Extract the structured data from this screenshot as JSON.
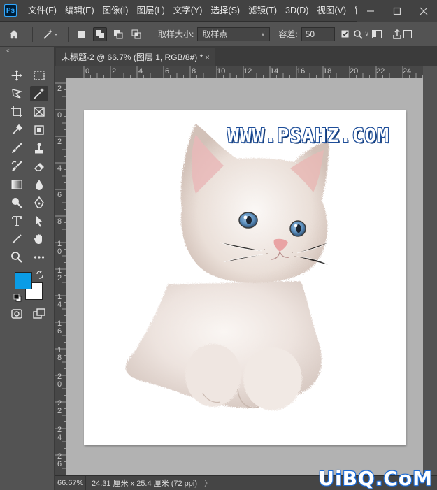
{
  "app": {
    "logo": "Ps",
    "menu": [
      "文件(F)",
      "编辑(E)",
      "图像(I)",
      "图层(L)",
      "文字(Y)",
      "选择(S)",
      "滤镜(T)",
      "3D(D)",
      "视图(V)",
      "窗口(W"
    ],
    "window_controls": [
      "minimize-icon",
      "maximize-icon",
      "close-icon"
    ]
  },
  "options": {
    "sample_size_label": "取样大小:",
    "sample_size_value": "取样点",
    "tolerance_label": "容差:",
    "tolerance_value": "50"
  },
  "document": {
    "tab_title": "未标题-2 @ 66.7% (图层 1, RGB/8#) *",
    "tab_close": "×"
  },
  "rulers": {
    "top": [
      "0",
      "2",
      "4",
      "6",
      "8",
      "10",
      "12",
      "14",
      "16",
      "18",
      "20",
      "22",
      "24"
    ],
    "left": [
      "2",
      "0",
      "2",
      "4",
      "6",
      "8",
      "1 0",
      "1 2",
      "1 4",
      "1 6",
      "1 8",
      "2 0",
      "2 2",
      "2 4",
      "2 6"
    ]
  },
  "canvas": {
    "watermark_text": "WWW.PSAHZ.COM",
    "foreground_color": "#0a9ce6",
    "background_color": "#ffffff"
  },
  "status": {
    "zoom": "66.67%",
    "doc_size": "24.31 厘米 x 25.4 厘米 (72 ppi)",
    "arrow": "〉"
  },
  "site_watermark": "UiBQ.CoM"
}
